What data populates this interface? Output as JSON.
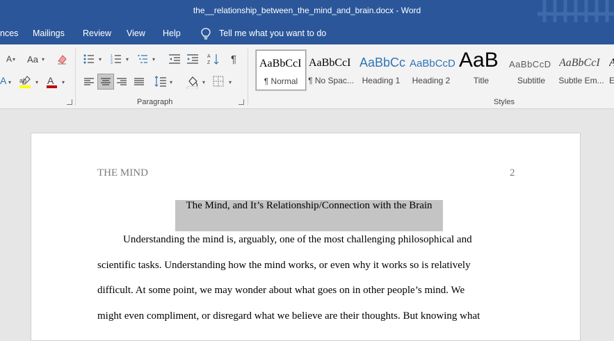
{
  "window": {
    "title": "the__relationship_between_the_mind_and_brain.docx  -  Word"
  },
  "tabs": {
    "references_partial": "nces",
    "mailings": "Mailings",
    "review": "Review",
    "view": "View",
    "help": "Help"
  },
  "tell_me": "Tell me what you want to do",
  "font_group": {
    "font_size_down": "A",
    "change_case": "Aa"
  },
  "paragraph_group": {
    "label": "Paragraph",
    "pilcrow": "¶"
  },
  "styles_group": {
    "label": "Styles",
    "items": [
      {
        "preview": "AaBbCcI",
        "name": "¶ Normal",
        "selected": true
      },
      {
        "preview": "AaBbCcI",
        "name": "¶ No Spac..."
      },
      {
        "preview": "AaBbCc",
        "name": "Heading 1",
        "color": "#2e74b5"
      },
      {
        "preview": "AaBbCcD",
        "name": "Heading 2",
        "color": "#2e74b5"
      },
      {
        "preview": "AaB",
        "name": "Title"
      },
      {
        "preview": "AaBbCcD",
        "name": "Subtitle",
        "color": "#5a5a5a"
      },
      {
        "preview": "AaBbCcI",
        "name": "Subtle Em...",
        "italic": true
      },
      {
        "preview": "A",
        "name": "E"
      }
    ]
  },
  "document": {
    "header": "THE MIND",
    "page_number": "2",
    "title": "The Mind, and It’s Relationship/Connection with the Brain",
    "lines": [
      "Understanding the mind is, arguably, one of the most challenging philosophical and",
      "scientific tasks. Understanding how the mind works, or even why it works so is relatively",
      "difficult. At some point, we may wonder about what goes on in other people’s mind. We",
      "might even compliment, or disregard what we believe are their thoughts. But knowing what"
    ]
  },
  "colors": {
    "ribbon_blue": "#2b579a",
    "highlight": "#c4c4c4",
    "font_color_red": "#c00000",
    "highlight_yellow": "#ffff00"
  }
}
